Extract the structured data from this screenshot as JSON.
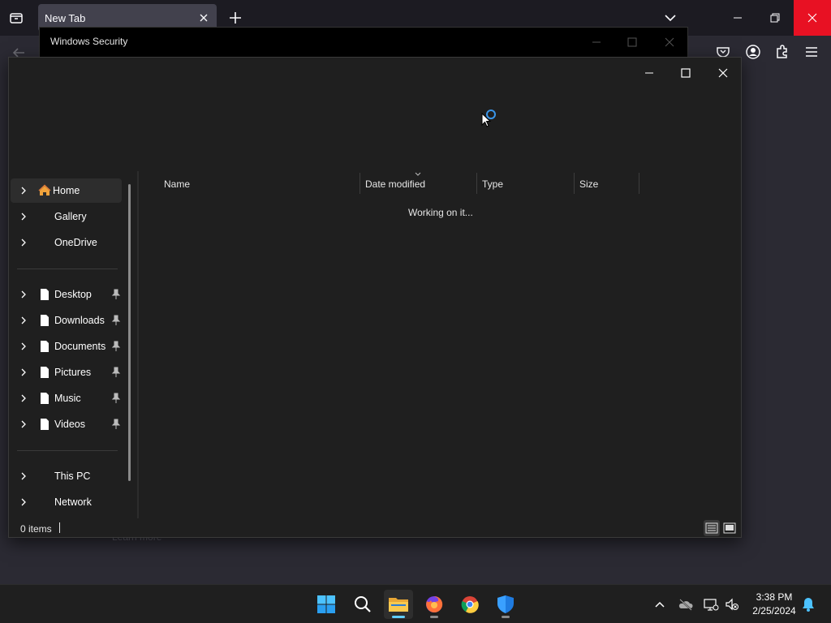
{
  "browser": {
    "tab_title": "New Tab",
    "learn_more": "Learn more"
  },
  "security_window": {
    "title": "Windows Security"
  },
  "dialog": {
    "nav_items": [
      {
        "label": "Home",
        "icon": "home-icon"
      },
      {
        "label": "Gallery"
      },
      {
        "label": "OneDrive"
      },
      {
        "label": "Desktop",
        "icon": "file-icon",
        "pinned": true
      },
      {
        "label": "Downloads",
        "icon": "file-icon",
        "pinned": true
      },
      {
        "label": "Documents",
        "icon": "file-icon",
        "pinned": true
      },
      {
        "label": "Pictures",
        "icon": "file-icon",
        "pinned": true
      },
      {
        "label": "Music",
        "icon": "file-icon",
        "pinned": true
      },
      {
        "label": "Videos",
        "icon": "file-icon",
        "pinned": true
      },
      {
        "label": "This PC"
      },
      {
        "label": "Network"
      }
    ],
    "columns": [
      "Name",
      "Date modified",
      "Type",
      "Size"
    ],
    "working_text": "Working on it...",
    "status_text": "0 items"
  },
  "taskbar": {
    "apps": [
      "start-icon",
      "search-icon",
      "file-explorer-icon",
      "firefox-icon",
      "chrome-icon",
      "windows-security-icon"
    ],
    "time": "3:38 PM",
    "date": "2/25/2024"
  },
  "colors": {
    "accent": "#60cdff",
    "close_red": "#e81123",
    "spinner": "#3a95e8"
  }
}
